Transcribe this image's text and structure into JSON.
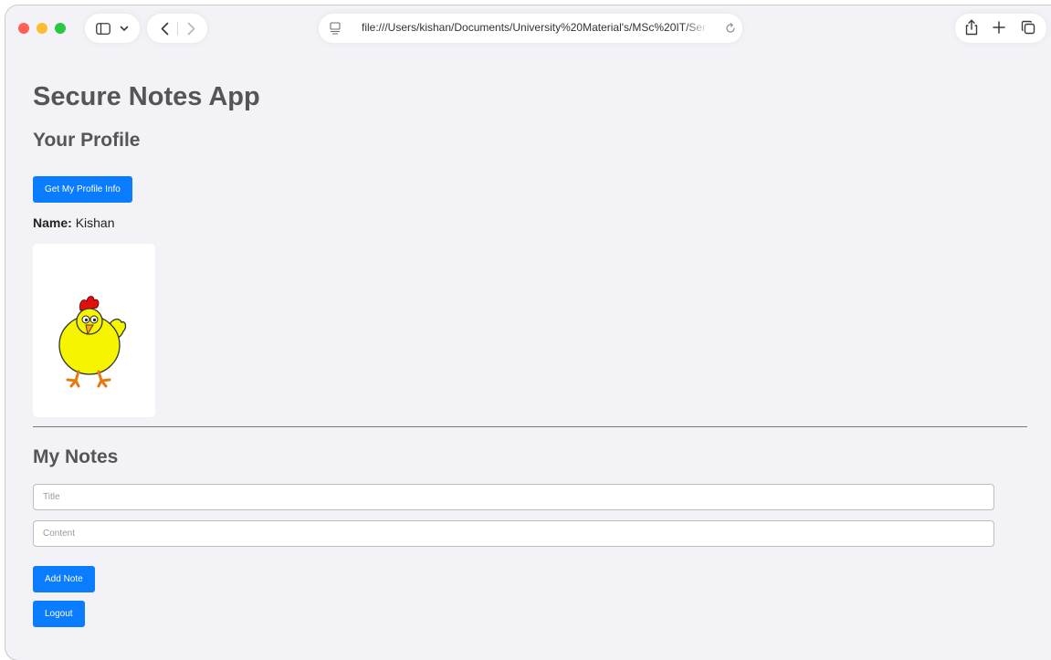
{
  "browser": {
    "url": "file:///Users/kishan/Documents/University%20Material's/MSc%20IT/Ser"
  },
  "page": {
    "app_title": "Secure Notes App",
    "profile_heading": "Your Profile",
    "profile_button_label": "Get My Profile Info",
    "name_label": "Name:",
    "name_value": "Kishan",
    "notes_heading": "My Notes",
    "title_placeholder": "Title",
    "content_placeholder": "Content",
    "add_note_label": "Add Note",
    "logout_label": "Logout"
  },
  "colors": {
    "accent": "#0a7cff",
    "background": "#f2f2f7"
  }
}
